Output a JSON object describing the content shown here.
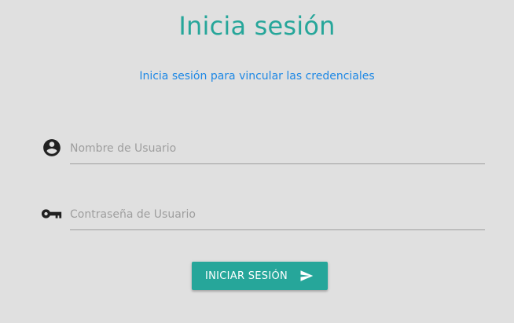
{
  "header": {
    "title": "Inicia sesión",
    "subtitle": "Inicia sesión para vincular las credenciales"
  },
  "form": {
    "username": {
      "icon": "account-circle-icon",
      "value": "",
      "placeholder": "Nombre de Usuario"
    },
    "password": {
      "icon": "key-icon",
      "value": "",
      "placeholder": "Contraseña de Usuario"
    },
    "submit": {
      "label": "INICIAR SESIÓN",
      "icon": "send-icon"
    }
  },
  "colors": {
    "background": "#e0e0e0",
    "accent": "#26a69a",
    "subtitle": "#1e88e5",
    "icon": "#212121"
  }
}
